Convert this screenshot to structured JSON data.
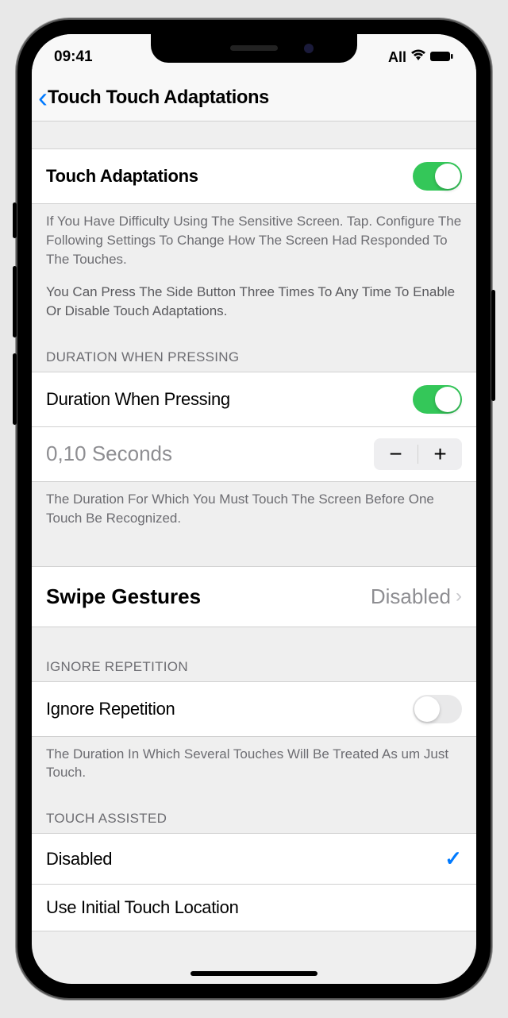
{
  "status_bar": {
    "time": "09:41",
    "carrier": "All"
  },
  "nav": {
    "title": "Touch Touch Adaptations"
  },
  "section1": {
    "label": "Touch Adaptations",
    "toggle_on": true,
    "footer1": "If You Have Difficulty Using The Sensitive Screen. Tap. Configure The Following Settings To Change How The Screen Had Responded To The Touches.",
    "footer2": "You Can Press The Side Button Three Times To Any Time To Enable Or Disable Touch Adaptations."
  },
  "section2": {
    "header": "DURATION WHEN PRESSING",
    "label": "Duration When Pressing",
    "toggle_on": true,
    "duration_value": "0,10 Seconds",
    "footer": "The Duration For Which You Must Touch The Screen Before One Touch Be Recognized."
  },
  "section3": {
    "label": "Swipe Gestures",
    "value": "Disabled"
  },
  "section4": {
    "header": "IGNORE REPETITION",
    "label": "Ignore Repetition",
    "toggle_on": false,
    "footer": "The Duration In Which Several Touches Will Be Treated As um Just Touch."
  },
  "section5": {
    "header": "TOUCH ASSISTED",
    "option1": "Disabled",
    "option2": "Use Initial Touch Location"
  }
}
